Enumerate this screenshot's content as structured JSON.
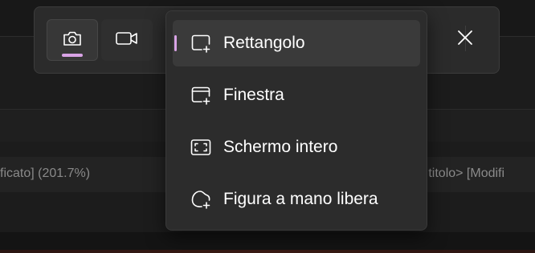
{
  "background": {
    "row_text_left": "ficato] (201.7%)",
    "row_text_right": "a titolo> [Modifi"
  },
  "toolbar": {
    "modes": [
      {
        "name": "screenshot",
        "icon": "camera-icon",
        "active": true
      },
      {
        "name": "recording",
        "icon": "video-camera-icon",
        "active": false
      }
    ],
    "accent_color": "#d9a3e6",
    "close_icon": "close-icon"
  },
  "snip_menu": {
    "items": [
      {
        "label": "Rettangolo",
        "icon": "rectangle-snip-icon",
        "selected": true
      },
      {
        "label": "Finestra",
        "icon": "window-snip-icon",
        "selected": false
      },
      {
        "label": "Schermo intero",
        "icon": "fullscreen-snip-icon",
        "selected": false
      },
      {
        "label": "Figura a mano libera",
        "icon": "freeform-snip-icon",
        "selected": false
      }
    ]
  }
}
